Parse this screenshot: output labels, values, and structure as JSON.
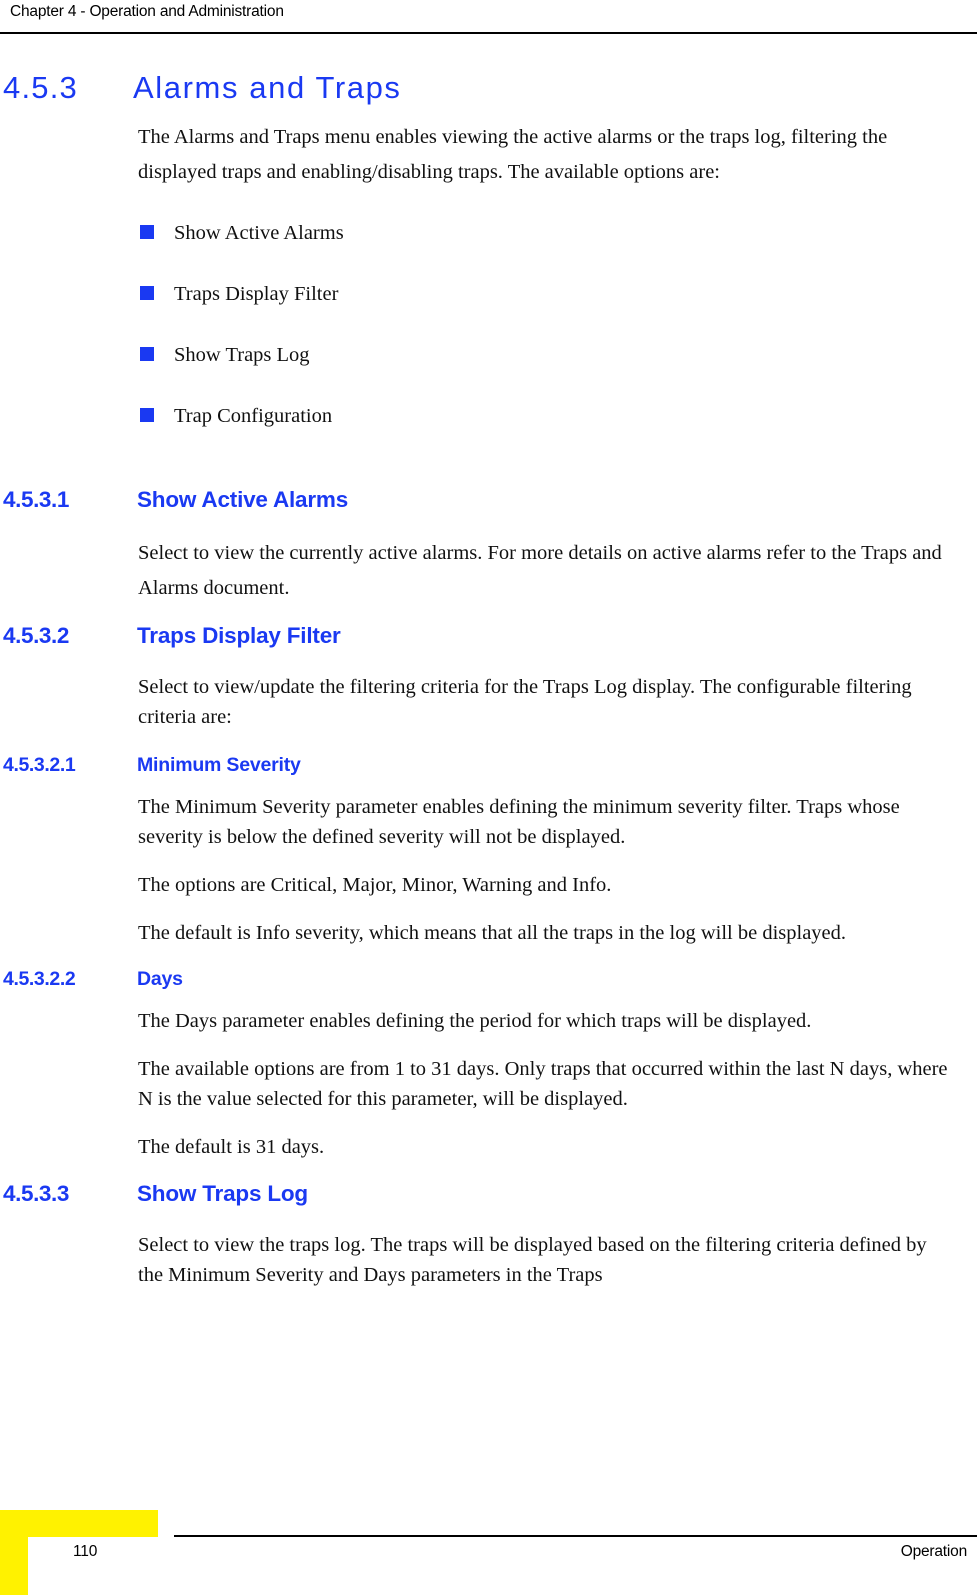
{
  "header": {
    "chapter_label": "Chapter 4 - Operation and Administration"
  },
  "section": {
    "number": "4.5.3",
    "title": "Alarms and Traps",
    "intro": "The Alarms and Traps menu enables viewing the active alarms or the traps log, filtering the displayed traps and enabling/disabling traps. The available options are:",
    "bullets": [
      "Show Active Alarms",
      "Traps Display Filter",
      "Show Traps Log",
      "Trap Configuration"
    ]
  },
  "subsections": [
    {
      "number": "4.5.3.1",
      "title": "Show Active Alarms",
      "paragraphs": [
        "Select to view the currently active alarms. For more details on active alarms refer to the Traps and Alarms document."
      ]
    },
    {
      "number": "4.5.3.2",
      "title": "Traps Display Filter",
      "paragraphs": [
        "Select to view/update the filtering criteria for the Traps Log display. The configurable filtering criteria are:"
      ]
    },
    {
      "number": "4.5.3.2.1",
      "title": "Minimum Severity",
      "paragraphs": [
        "The Minimum Severity parameter enables defining the minimum severity filter. Traps whose severity is below the defined severity will not be displayed.",
        "The options are Critical, Major, Minor, Warning and Info.",
        "The default is Info severity, which means that all the traps in the log will be displayed."
      ]
    },
    {
      "number": "4.5.3.2.2",
      "title": "Days",
      "paragraphs": [
        "The Days parameter enables defining the period for which traps will be displayed.",
        "The available options are from 1 to 31 days. Only traps that occurred within the last N days, where N is the value selected for this parameter, will be displayed.",
        "The default is 31 days."
      ]
    },
    {
      "number": "4.5.3.3",
      "title": "Show Traps Log",
      "paragraphs": [
        "Select to view the traps log. The traps will be displayed based on the filtering criteria defined by the Minimum Severity and Days parameters in the Traps"
      ]
    }
  ],
  "footer": {
    "page_number": "110",
    "section_label": "Operation"
  },
  "colors": {
    "heading_blue": "#1a39f2",
    "bullet_blue": "#1a39f2",
    "footer_yellow": "#fff200",
    "rule_black": "#000000"
  }
}
